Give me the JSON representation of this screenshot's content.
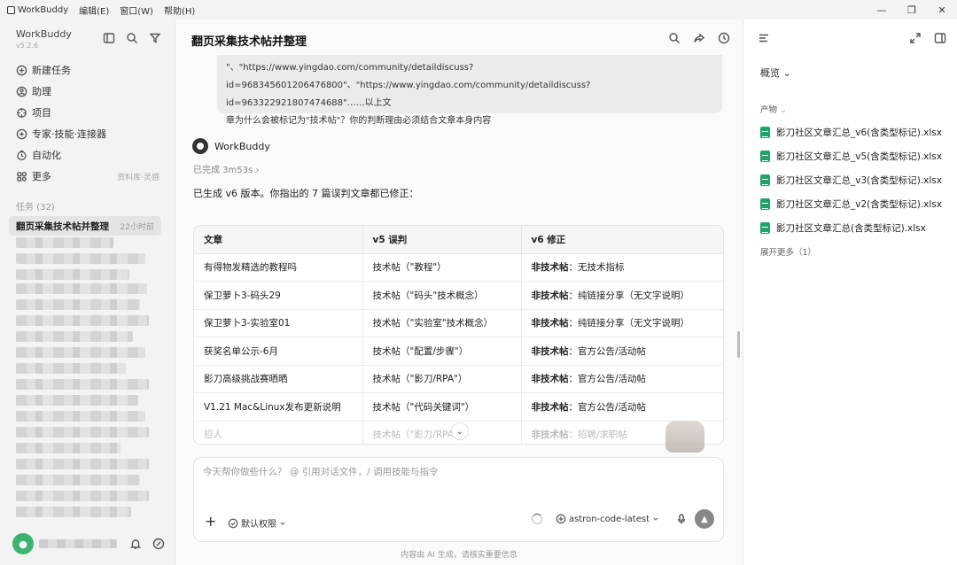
{
  "titlebar": {
    "app_name": "WorkBuddy",
    "menus": [
      "编辑(E)",
      "窗口(W)",
      "帮助(H)"
    ],
    "minimize": "—",
    "maximize": "❐",
    "close": "✕"
  },
  "sidebar": {
    "brand": "WorkBuddy",
    "version": "v5.2.6",
    "nav": [
      {
        "label": "新建任务",
        "icon": "plus-circle-icon"
      },
      {
        "label": "助理",
        "icon": "assistant-icon"
      },
      {
        "label": "项目",
        "icon": "project-icon"
      },
      {
        "label": "专家·技能·连接器",
        "icon": "expert-icon"
      },
      {
        "label": "自动化",
        "icon": "automation-icon"
      },
      {
        "label": "更多",
        "icon": "more-grid-icon",
        "extra": "资料库·灵感"
      }
    ],
    "tasks_label": "任务 (32)",
    "active_task": "翻页采集技术帖并整理",
    "active_task_time": "22小时前"
  },
  "main": {
    "title": "翻页采集技术帖并整理",
    "quote_lines": [
      "\"、\"https://www.yingdao.com/community/detaildiscuss?",
      "id=968345601206476800\"、\"https://www.yingdao.com/community/detaildiscuss?id=963322921807474688\"……以上文",
      "章为什么会被标记为\"技术帖\"？你的判断理由必须结合文章本身内容"
    ],
    "assistant_name": "WorkBuddy",
    "done_text": "已完成 3m53s",
    "done_chevron": "›",
    "summary": "已生成 v6 版本。你指出的 7 篇误判文章都已修正：",
    "table": {
      "headers": [
        "文章",
        "v5 误判",
        "v6 修正"
      ],
      "rows": [
        {
          "article": "有得物发精选的教程吗",
          "v5": "技术帖（\"教程\"）",
          "v6_bold": "非技术帖",
          "v6_rest": "：无技术指标"
        },
        {
          "article": "保卫萝卜3-码头29",
          "v5": "技术帖（\"码头\"技术概念）",
          "v6_bold": "非技术帖",
          "v6_rest": "：纯链接分享（无文字说明）"
        },
        {
          "article": "保卫萝卜3-实验室01",
          "v5": "技术帖（\"实验室\"技术概念）",
          "v6_bold": "非技术帖",
          "v6_rest": "：纯链接分享（无文字说明）"
        },
        {
          "article": "获奖名单公示-6月",
          "v5": "技术帖（\"配置/步骤\"）",
          "v6_bold": "非技术帖",
          "v6_rest": "：官方公告/活动帖"
        },
        {
          "article": "影刀高级挑战赛晒晒",
          "v5": "技术帖（\"影刀/RPA\"）",
          "v6_bold": "非技术帖",
          "v6_rest": "：官方公告/活动帖"
        },
        {
          "article": "V1.21 Mac&Linux发布更新说明",
          "v5": "技术帖（\"代码关键词\"）",
          "v6_bold": "非技术帖",
          "v6_rest": "：官方公告/活动帖"
        },
        {
          "article": "招人",
          "v5": "技术帖（\"影刀/RPA\"）",
          "v6_bold": "非技术帖",
          "v6_rest": "：招聘/求职帖"
        }
      ]
    },
    "scroll_down_glyph": "⌄",
    "input_placeholder": "今天帮你做些什么？ @ 引用对话文件，/ 调用技能与指令",
    "plus_glyph": "+",
    "permission_label": "默认权限",
    "model_label": "astron-code-latest",
    "send_glyph": "▲",
    "footer": "内容由 AI 生成，请核实重要信息"
  },
  "right_panel": {
    "overview_label": "概览",
    "products_label": "产物",
    "files": [
      "影刀社区文章汇总_v6(含类型标记).xlsx",
      "影刀社区文章汇总_v5(含类型标记).xlsx",
      "影刀社区文章汇总_v3(含类型标记).xlsx",
      "影刀社区文章汇总_v2(含类型标记).xlsx",
      "影刀社区文章汇总(含类型标记).xlsx"
    ],
    "more_label": "展开更多（1）"
  }
}
